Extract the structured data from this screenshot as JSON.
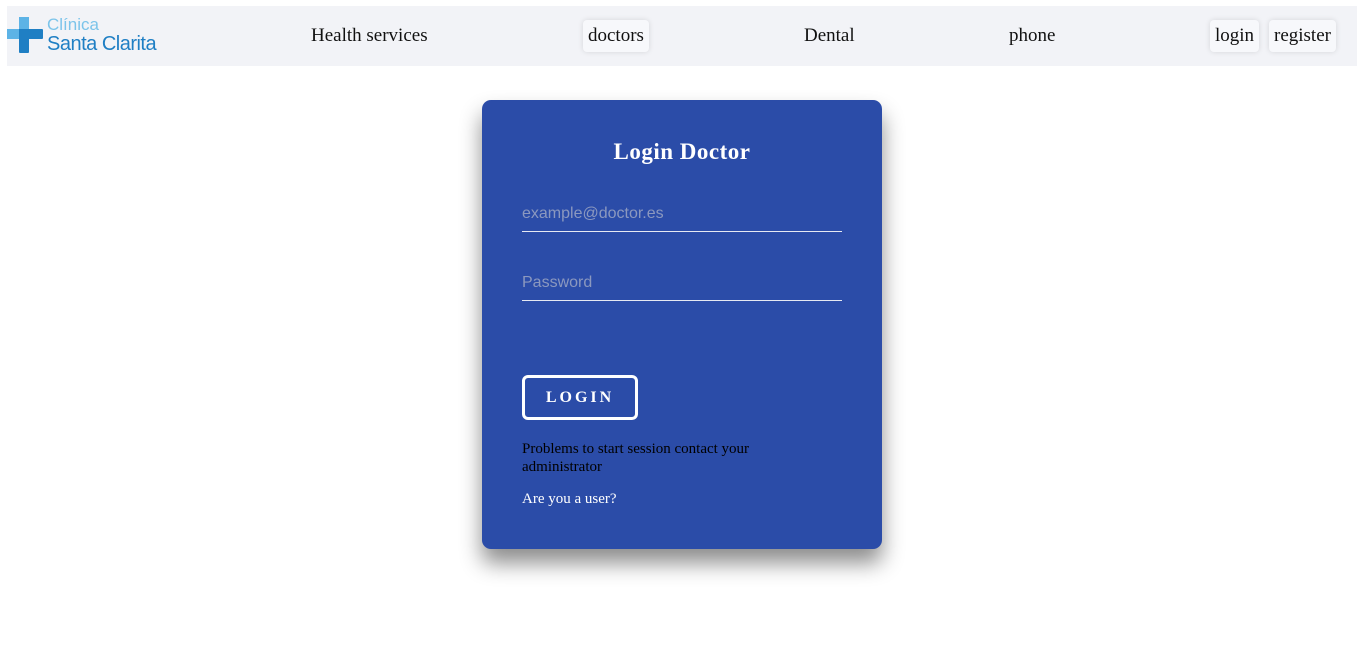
{
  "brand": {
    "line1": "Clínica",
    "line2": "Santa Clarita",
    "icon": "medical-cross-icon",
    "colors": {
      "light": "#7cc4ea",
      "dark": "#1f7fc4"
    }
  },
  "nav": {
    "health_services": "Health services",
    "doctors": "doctors",
    "dental": "Dental",
    "phone": "phone",
    "login": "login",
    "register": "register"
  },
  "login_form": {
    "title": "Login Doctor",
    "email_placeholder": "example@doctor.es",
    "email_value": "",
    "password_placeholder": "Password",
    "password_value": "",
    "submit_label": "LOGIN",
    "problems_text": "Problems to start session contact your administrator",
    "user_link": "Are you a user?"
  },
  "colors": {
    "card_bg": "#2b4ca8",
    "navbar_bg": "#f2f3f7",
    "page_bg": "#ffffff"
  }
}
